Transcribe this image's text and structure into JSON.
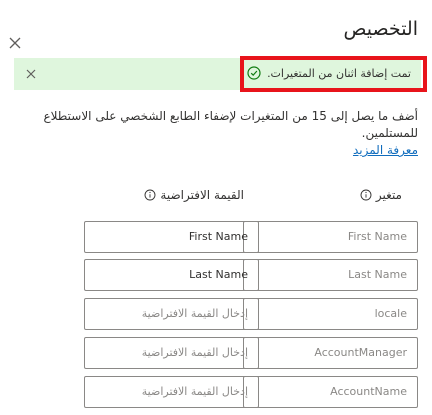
{
  "panel": {
    "title": "التخصيص"
  },
  "banner": {
    "message": "تمت إضافة اثنان من المتغيرات."
  },
  "description": {
    "text": "أضف ما يصل إلى 15 من المتغيرات لإضفاء الطابع الشخصي على الاستطلاع للمستلمين.",
    "link_label": "معرفة المزيد"
  },
  "columns": {
    "variable": "متغير",
    "default_value": "القيمة الافتراضية"
  },
  "rows": [
    {
      "variable": "First Name",
      "default_value": "First Name",
      "is_placeholder": false
    },
    {
      "variable": "Last Name",
      "default_value": "Last Name",
      "is_placeholder": false
    },
    {
      "variable": "locale",
      "default_value": "إدخال القيمة الافتراضية",
      "is_placeholder": true
    },
    {
      "variable": "AccountManager",
      "default_value": "إدخال القيمة الافتراضية",
      "is_placeholder": true
    },
    {
      "variable": "AccountName",
      "default_value": "إدخال القيمة الافتراضية",
      "is_placeholder": true
    }
  ],
  "colors": {
    "success_background": "#dff6dd",
    "success_icon": "#107c10",
    "link": "#0f6cbd",
    "highlight_border": "#e8141b"
  },
  "icons": {
    "close_panel": "close-icon",
    "banner_dismiss": "close-icon",
    "banner_status": "checkmark-circle-icon",
    "column_info": "info-icon"
  }
}
